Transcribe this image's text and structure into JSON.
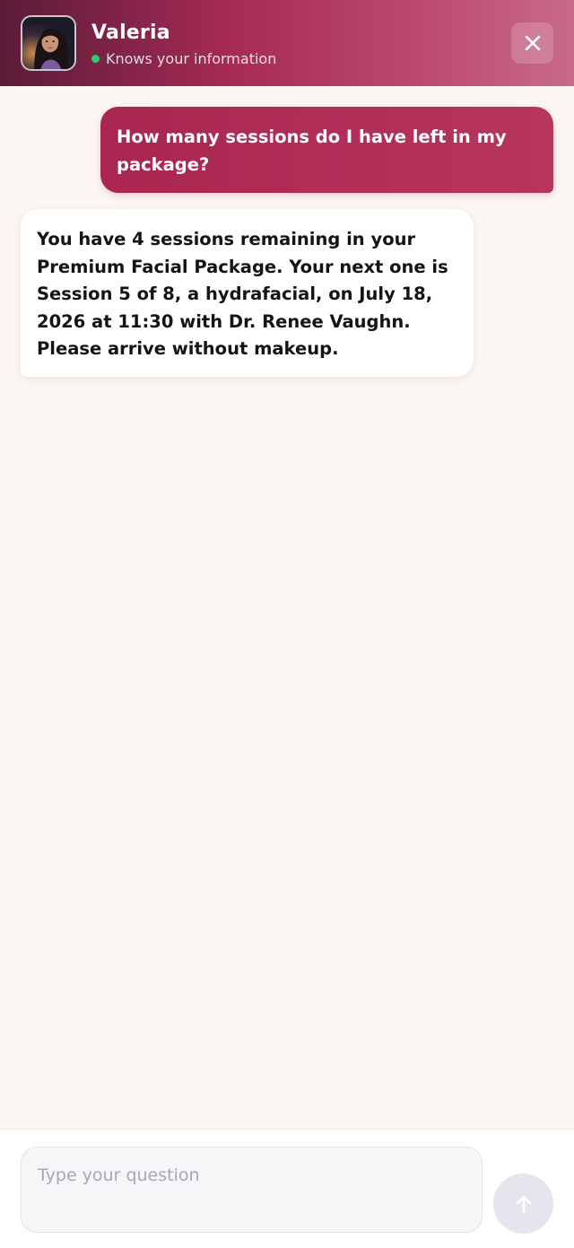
{
  "header": {
    "agent_name": "Valeria",
    "status_text": "Knows your information",
    "status_color": "#2ecc71",
    "close_icon": "close-icon",
    "avatar_icon": "avatar-portrait"
  },
  "messages": [
    {
      "role": "user",
      "text": "How many sessions do I have left in my package?"
    },
    {
      "role": "assistant",
      "text": "You have 4 sessions remaining in your Premium Facial Package. Your next one is Session 5 of 8, a hydrafacial, on July 18, 2026 at 11:30 with Dr. Renee Vaughn. Please arrive without makeup."
    }
  ],
  "composer": {
    "placeholder": "Type your question",
    "value": "",
    "send_icon": "arrow-up-icon"
  },
  "colors": {
    "brand": "#a8264f",
    "background": "#fcf6f3"
  }
}
